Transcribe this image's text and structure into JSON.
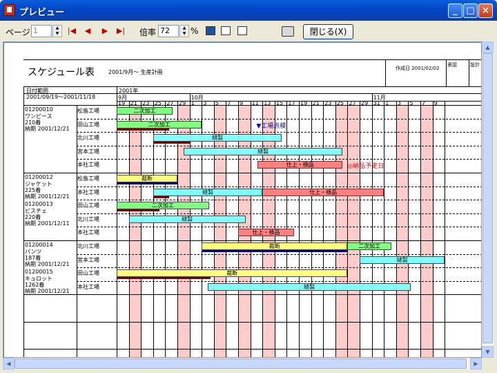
{
  "window": {
    "title": "プレビュー",
    "minimize": "_",
    "maximize": "□",
    "close": "×"
  },
  "toolbar": {
    "page_label": "ページ",
    "page_value": "1",
    "zoom_label": "倍率",
    "zoom_value": "72",
    "percent": "%",
    "close_label": "閉じる(X)"
  },
  "report": {
    "title": "スケジュール表",
    "subtitle": "2001/9月～ 生産計画",
    "created": "作成日 2001/02/02",
    "stamp1": "承認",
    "stamp2": "設計",
    "date_range_label": "日付範囲",
    "date_range": "2001/09/19～2001/11/18",
    "year": "2001年",
    "months": [
      {
        "label": "9月",
        "day_index": 0
      },
      {
        "label": "10月",
        "day_index": 6
      },
      {
        "label": "11月",
        "day_index": 21
      }
    ],
    "days": [
      "19",
      "21",
      "23",
      "25",
      "27",
      "29",
      "1",
      "3",
      "5",
      "7",
      "9",
      "11",
      "13",
      "15",
      "17",
      "19",
      "21",
      "23",
      "25",
      "27",
      "29",
      "31",
      "1",
      "3",
      "5",
      "7",
      "9"
    ],
    "shaded_days": [
      1,
      5,
      8,
      10,
      12,
      18,
      19,
      23,
      25
    ],
    "products": [
      {
        "code": "01200010",
        "name": "ワンピース",
        "qty": "210着",
        "deadline": "納期 2001/12/21",
        "row": 0
      },
      {
        "code": "01200012",
        "name": "ジャケット",
        "qty": "225着",
        "deadline": "納期 2001/12/21",
        "row": 5
      },
      {
        "code": "01200013",
        "name": "ビスチェ",
        "qty": "220着",
        "deadline": "納期 2001/12/11",
        "row": 7
      },
      {
        "code": "01200014",
        "name": "パンツ",
        "qty": "187着",
        "deadline": "納期 2001/12/21",
        "row": 10
      },
      {
        "code": "01200015",
        "name": "キュロット",
        "qty": "1262着",
        "deadline": "納期 2001/12/21",
        "row": 12
      }
    ],
    "rows": [
      {
        "factory": "松島工場"
      },
      {
        "factory": "田山工場"
      },
      {
        "factory": "北川工場"
      },
      {
        "factory": "宮本工場"
      },
      {
        "factory": "本社工場"
      },
      {
        "factory": "松島工場"
      },
      {
        "factory": "本社工場"
      },
      {
        "factory": "田山工場"
      },
      {
        "factory": "北川工場"
      },
      {
        "factory": "本社工場"
      },
      {
        "factory": "北川工場"
      },
      {
        "factory": "宮本工場"
      },
      {
        "factory": "田山工場"
      },
      {
        "factory": "本社工場"
      }
    ],
    "bars": [
      {
        "row": 0,
        "start": 0,
        "end": 4.6,
        "label": "二次加工",
        "color": "green"
      },
      {
        "row": 1,
        "start": 0,
        "end": 7,
        "label": "二次加工",
        "color": "green"
      },
      {
        "row": 2,
        "start": 3,
        "end": 13.6,
        "label": "縫製",
        "color": "cyan"
      },
      {
        "row": 3,
        "start": 5.5,
        "end": 18.6,
        "label": "縫製",
        "color": "cyan"
      },
      {
        "row": 4,
        "start": 11.6,
        "end": 18.6,
        "label": "仕上・検品",
        "color": "red"
      },
      {
        "row": 5,
        "start": 0,
        "end": 5,
        "label": "裁断",
        "color": "yellow"
      },
      {
        "row": 6,
        "start": 3,
        "end": 12,
        "label": "縫製",
        "color": "cyan"
      },
      {
        "row": 6,
        "start": 12,
        "end": 22,
        "label": "仕上・検品",
        "color": "red"
      },
      {
        "row": 7,
        "start": 0,
        "end": 7.6,
        "label": "二次加工",
        "color": "green"
      },
      {
        "row": 8,
        "start": 1,
        "end": 10.6,
        "label": "縫製",
        "color": "cyan"
      },
      {
        "row": 9,
        "start": 10,
        "end": 14.6,
        "label": "仕上・検品",
        "color": "red"
      },
      {
        "row": 10,
        "start": 7,
        "end": 19,
        "label": "裁断",
        "color": "yellow"
      },
      {
        "row": 10,
        "start": 19,
        "end": 22.6,
        "label": "二次加工",
        "color": "green"
      },
      {
        "row": 11,
        "start": 20,
        "end": 27,
        "label": "縫製",
        "color": "cyan"
      },
      {
        "row": 12,
        "start": 0,
        "end": 19,
        "label": "裁断",
        "color": "yellow"
      },
      {
        "row": 13,
        "start": 7.5,
        "end": 24.2,
        "label": "縫製",
        "color": "cyan"
      }
    ],
    "underlines": [
      {
        "row": 1,
        "start": 0,
        "end": 4.3,
        "color": "#800000"
      },
      {
        "row": 2,
        "start": 3,
        "end": 6,
        "color": "#800000"
      },
      {
        "row": 5,
        "start": 0,
        "end": 5,
        "color": "#000080"
      },
      {
        "row": 6,
        "start": 3,
        "end": 4.3,
        "color": "#800000"
      },
      {
        "row": 7,
        "start": 0,
        "end": 3.5,
        "color": "#800000"
      },
      {
        "row": 10,
        "start": 7,
        "end": 19,
        "color": "#000080"
      },
      {
        "row": 12,
        "start": 0,
        "end": 7.7,
        "color": "#800000"
      }
    ],
    "notes": [
      {
        "row": 1,
        "day": 11.5,
        "text": "▼工場点検",
        "color": "#0000c0"
      },
      {
        "row": 4,
        "day": 19,
        "text": "◎納品予定日",
        "color": "#e00000"
      }
    ]
  }
}
